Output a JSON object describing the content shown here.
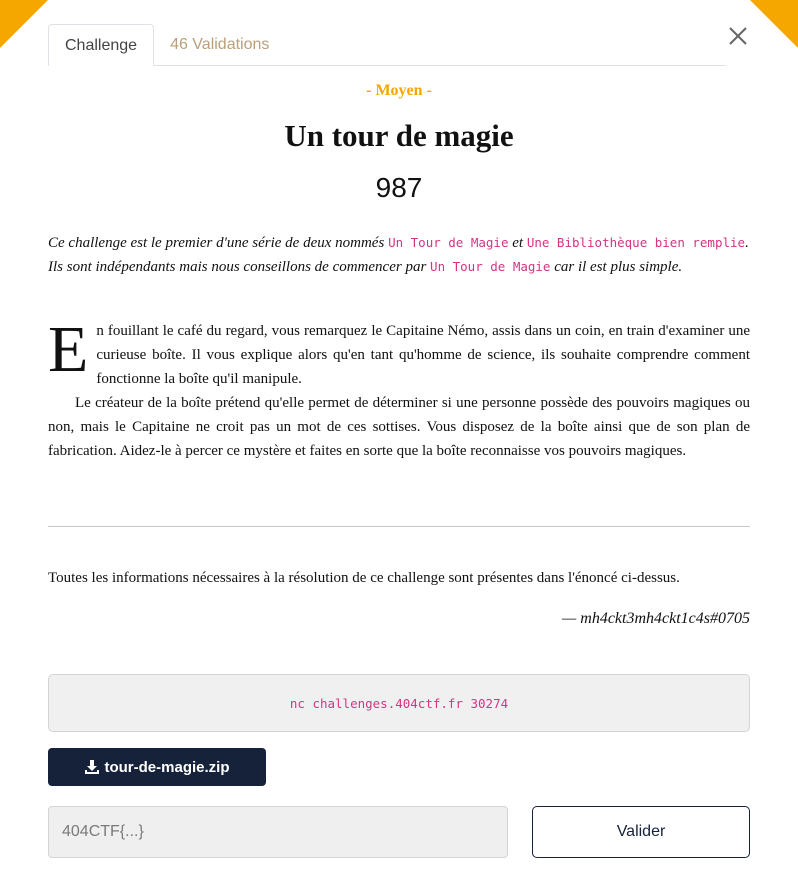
{
  "tabs": [
    {
      "label": "Challenge",
      "active": true
    },
    {
      "label": "46 Validations",
      "active": false
    }
  ],
  "challenge": {
    "difficulty": "- Moyen -",
    "title": "Un tour de magie",
    "points": "987"
  },
  "intro": {
    "t1": "Ce challenge est le premier d'une série de deux nommés ",
    "c1": "Un Tour de Magie",
    "t2": " et ",
    "c2": "Une Bibliothèque bien remplie",
    "t3": ". Ils sont indépendants mais nous conseillons de commencer par ",
    "c3": "Un Tour de Magie",
    "t4": " car il est plus simple."
  },
  "story": {
    "dropcap": "E",
    "p1": "n fouillant le café du regard, vous remarquez le Capitaine Némo, assis dans un coin, en train d'examiner une curieuse boîte. Il vous explique alors qu'en tant qu'homme de science, ils souhaite comprendre comment fonctionne la boîte qu'il manipule.",
    "p2": "Le créateur de la boîte prétend qu'elle permet de déterminer si une personne possède des pouvoirs magiques ou non, mais le Capitaine ne croit pas un mot de ces sottises. Vous disposez de la boîte ainsi que de son plan de fabrication. Aidez-le à percer ce mystère et faites en sorte que la boîte reconnaisse vos pouvoirs magiques."
  },
  "info_text": "Toutes les informations nécessaires à la résolution de ce challenge sont présentes dans l'énoncé ci-dessus.",
  "author": "— mh4ckt3mh4ckt1c4s#0705",
  "connection_command": "nc challenges.404ctf.fr 30274",
  "download": {
    "label": "tour-de-magie.zip",
    "icon": "download-icon"
  },
  "flag_form": {
    "placeholder": "404CTF{...}",
    "value": "",
    "submit_label": "Valider"
  },
  "colors": {
    "accent": "#f5a700",
    "code": "#d63384",
    "dark": "#15223a"
  },
  "icons": {
    "close": "close-icon",
    "download": "download-icon"
  }
}
